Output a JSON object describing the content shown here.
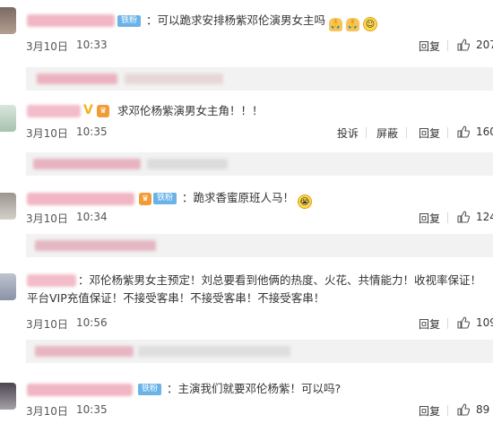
{
  "colors": {
    "accent": "#6ab3e8",
    "blur_pink": "#f2b9c6",
    "reply_bg": "#f2f2f2",
    "text": "#333333"
  },
  "actions": {
    "reply": "回复",
    "report": "投诉",
    "block": "屏蔽"
  },
  "comments": [
    {
      "badge": "铁粉",
      "text": "：可以跪求安排杨紫邓伦演男女主吗",
      "emojis": [
        "pray-icon",
        "pray-icon",
        "smiling-face-icon"
      ],
      "date": "3月10日",
      "time": "10:33",
      "likes": "207"
    },
    {
      "text": "求邓伦杨紫演男女主角！！！",
      "date": "3月10日",
      "time": "10:35",
      "likes": "160"
    },
    {
      "badge": "铁粉",
      "text": "：跪求香蜜原班人马！",
      "emojis": [
        "crying-face-icon"
      ],
      "date": "3月10日",
      "time": "10:34",
      "likes": "124"
    },
    {
      "text": "：邓伦杨紫男女主预定！刘总要看到他俩的热度、火花、共情能力！收视率保证！平台VIP充值保证！不接受客串！不接受客串！不接受客串！",
      "date": "3月10日",
      "time": "10:56",
      "likes": "109"
    },
    {
      "badge": "铁粉",
      "text": "：主演我们就要邓伦杨紫！可以吗?",
      "date": "3月10日",
      "time": "10:35",
      "likes": "89"
    }
  ]
}
